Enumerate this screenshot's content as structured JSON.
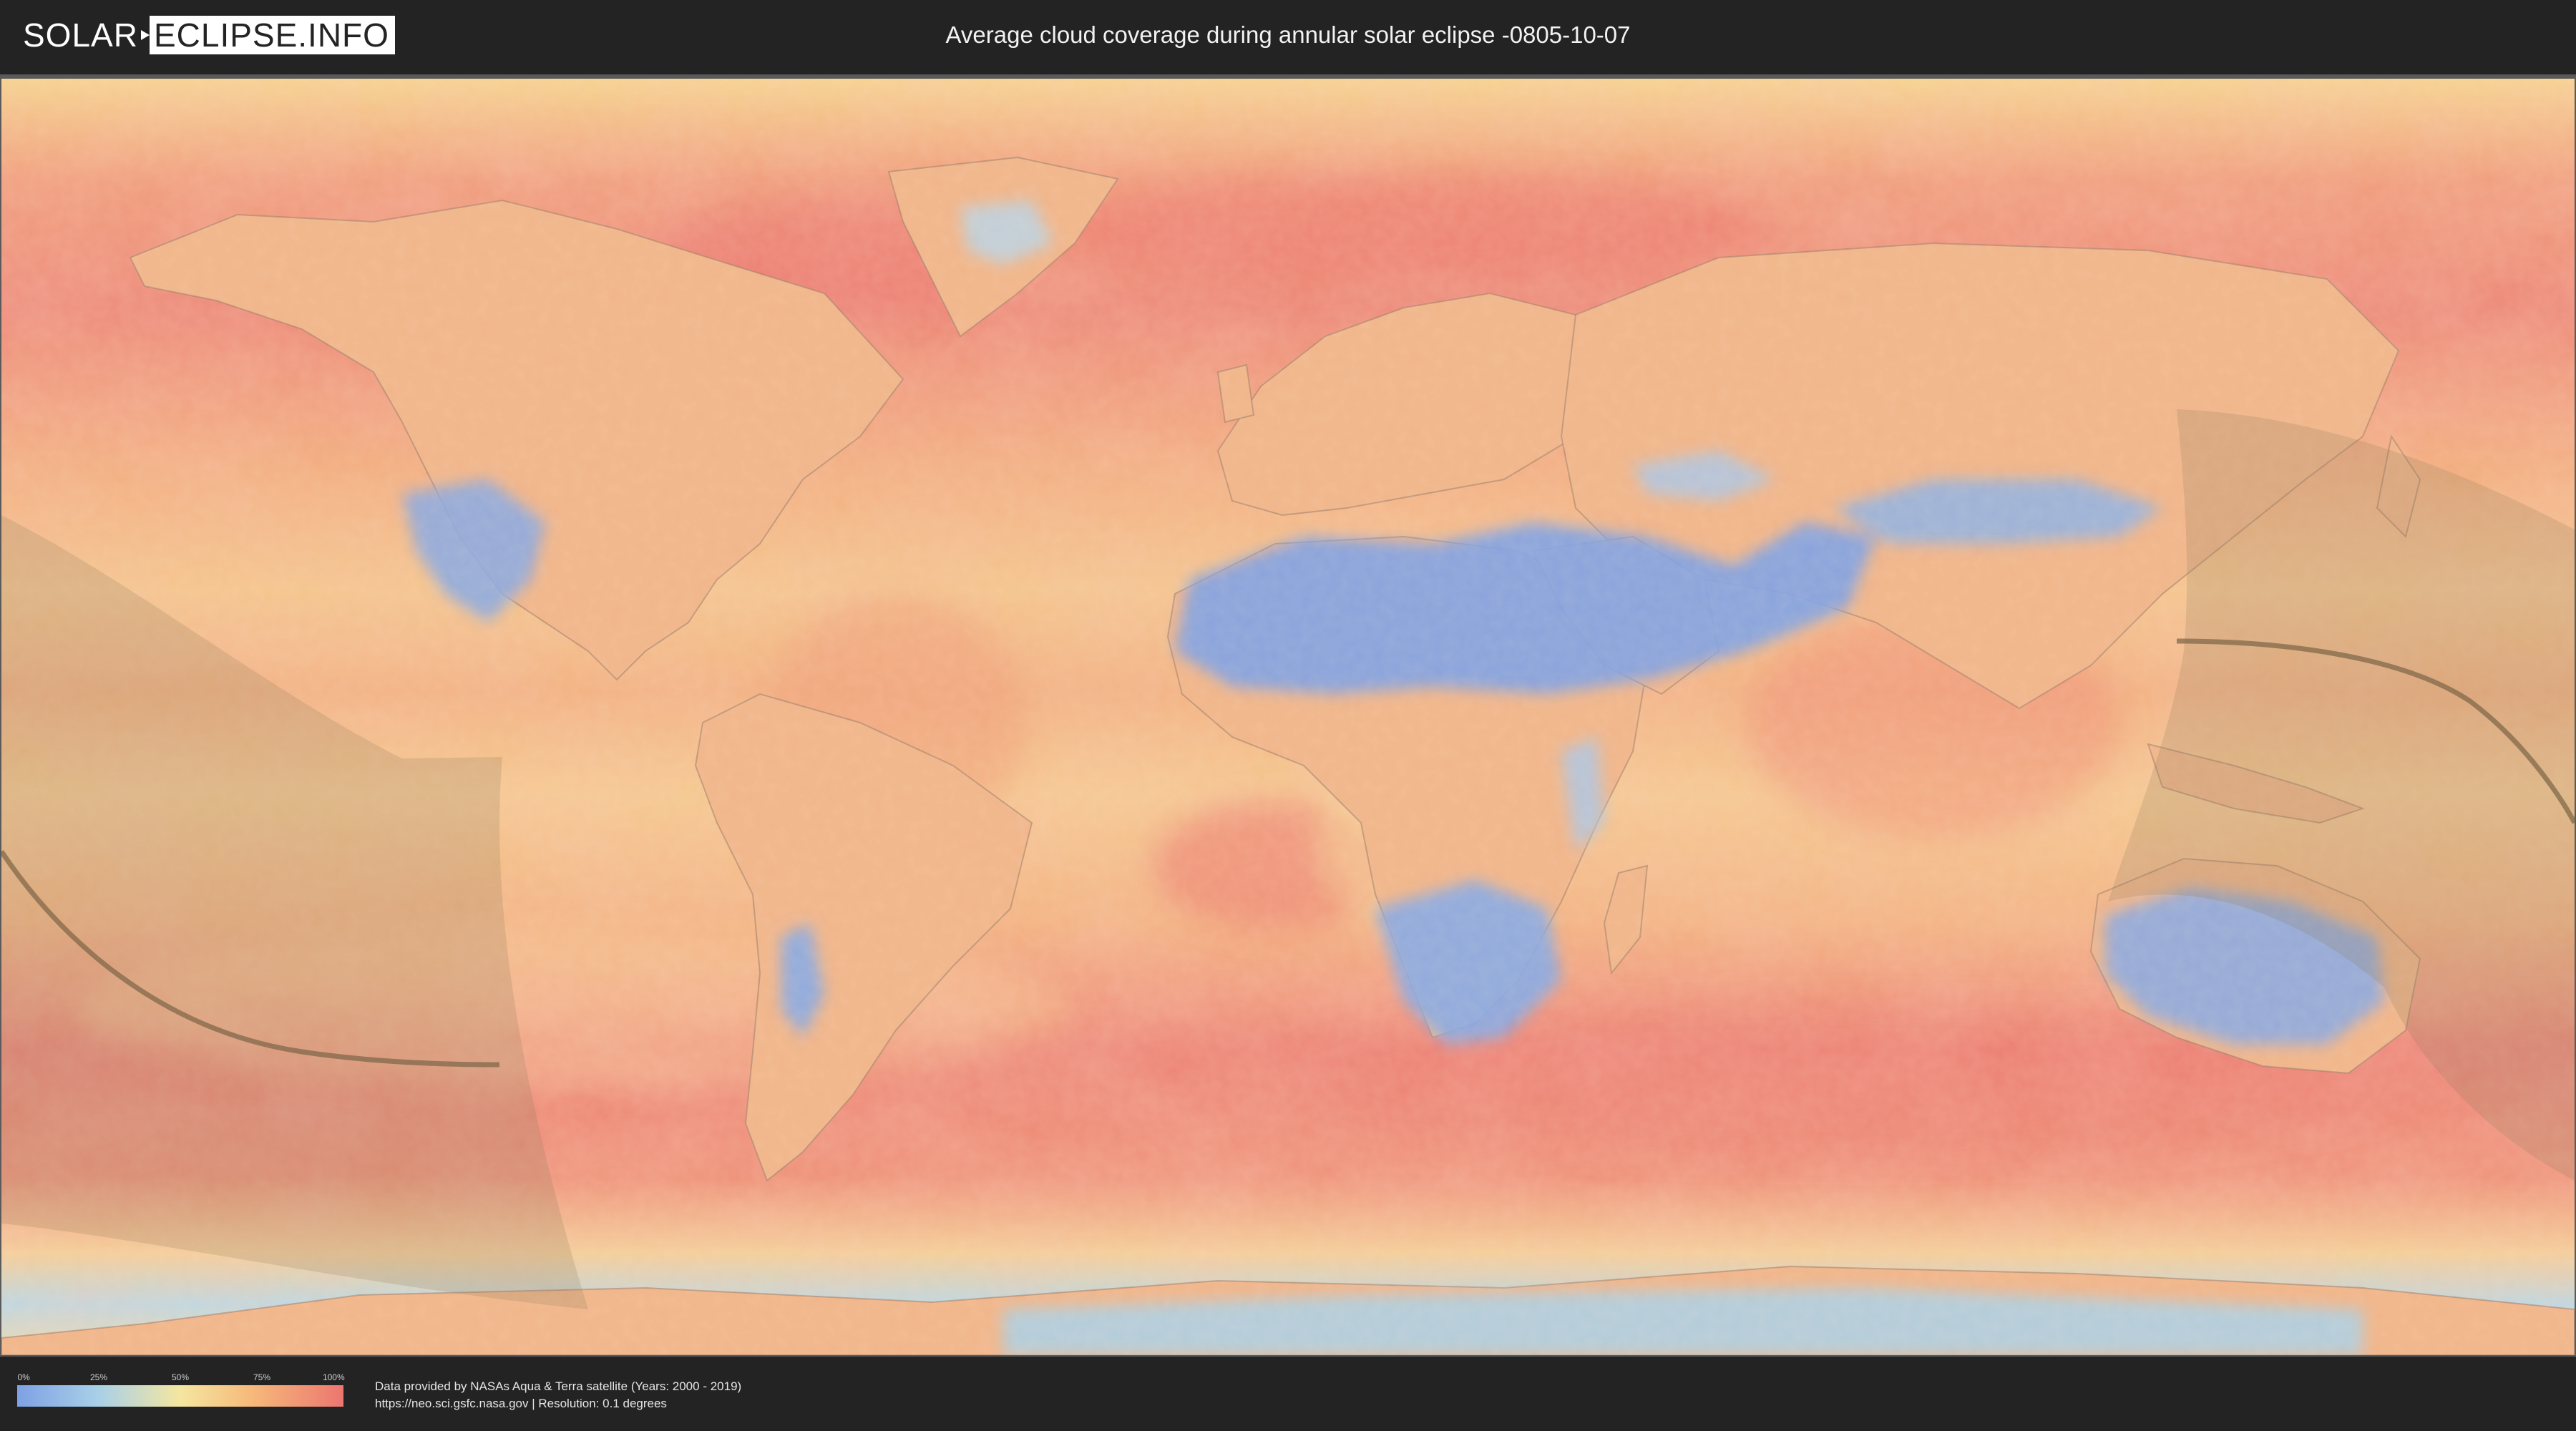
{
  "header": {
    "logo_left": "SOLAR",
    "logo_right": "ECLIPSE.INFO",
    "title": "Average cloud coverage during annular solar eclipse -0805-10-07"
  },
  "legend": {
    "ticks": [
      "0%",
      "25%",
      "50%",
      "75%",
      "100%"
    ],
    "colors": [
      "#7ea1e4",
      "#a9d0e8",
      "#f5e6a0",
      "#f6b97a",
      "#ec7670"
    ]
  },
  "credits": {
    "line1": "Data provided by NASAs Aqua & Terra satellite (Years: 2000 - 2019)",
    "line2": "https://neo.sci.gsfc.nasa.gov | Resolution: 0.1 degrees"
  },
  "map": {
    "colors": {
      "clear": "#7ea1e4",
      "low": "#a9d0e8",
      "mid": "#f5e6a0",
      "high": "#f6b97a",
      "overcast": "#ec7670",
      "eclipse_shadow": "#8c7a5a"
    }
  }
}
